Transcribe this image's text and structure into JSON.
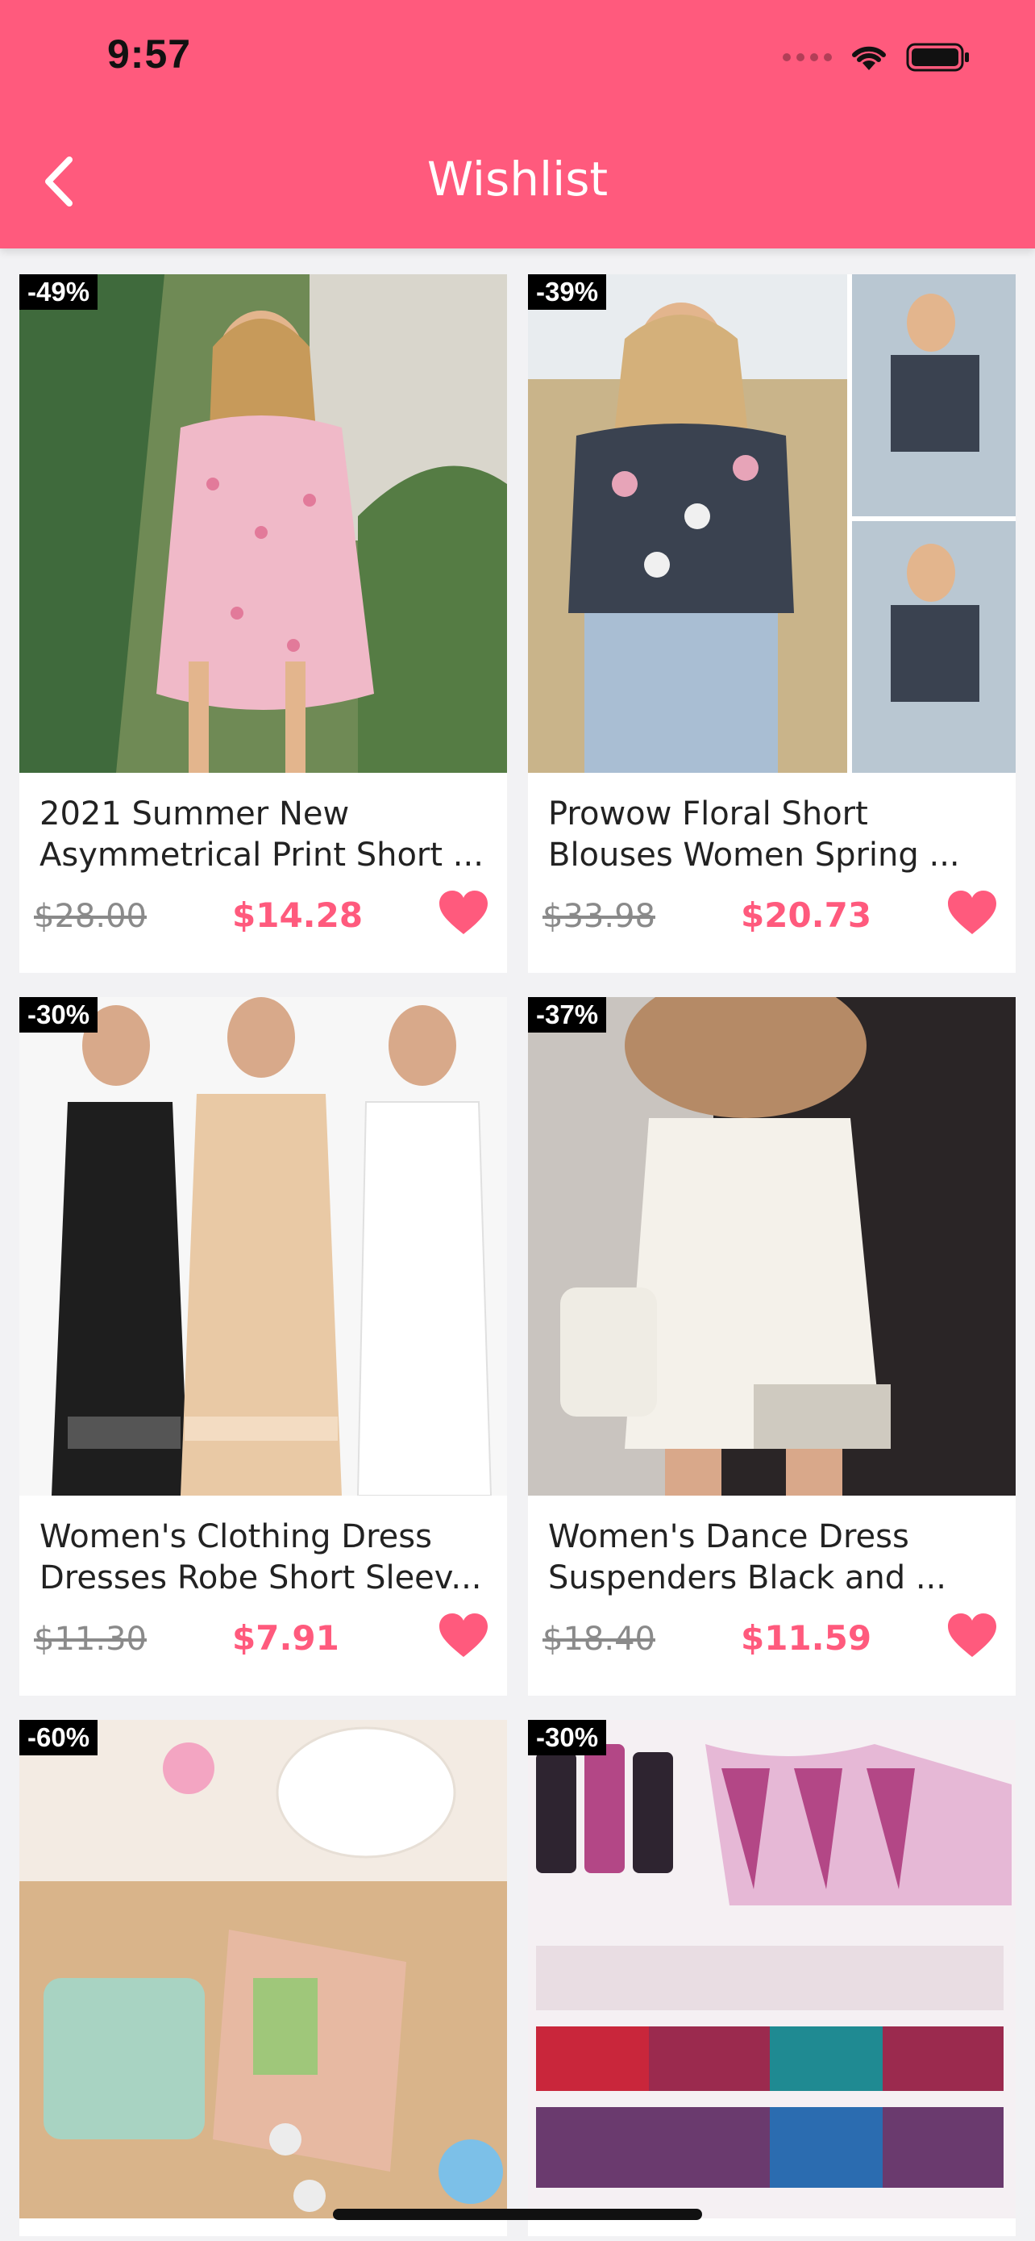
{
  "status_bar": {
    "time": "9:57"
  },
  "header": {
    "title": "Wishlist",
    "back_icon": "chevron-left-icon"
  },
  "colors": {
    "accent": "#ff5a7d",
    "badge_bg": "#000000",
    "old_price": "#8a8a8a"
  },
  "products": [
    {
      "discount": "-49%",
      "title": "2021 Summer New Asymmetrical Print Short ...",
      "old_price": "$28.00",
      "new_price": "$14.28",
      "liked": true
    },
    {
      "discount": "-39%",
      "title": "Prowow Floral Short Blouses Women Spring ...",
      "old_price": "$33.98",
      "new_price": "$20.73",
      "liked": true
    },
    {
      "discount": "-30%",
      "title": "Women's Clothing Dress Dresses Robe Short Sleev...",
      "old_price": "$11.30",
      "new_price": "$7.91",
      "liked": true
    },
    {
      "discount": "-37%",
      "title": "Women's Dance Dress Suspenders Black and ...",
      "old_price": "$18.40",
      "new_price": "$11.59",
      "liked": true
    },
    {
      "discount": "-60%"
    },
    {
      "discount": "-30%"
    }
  ]
}
